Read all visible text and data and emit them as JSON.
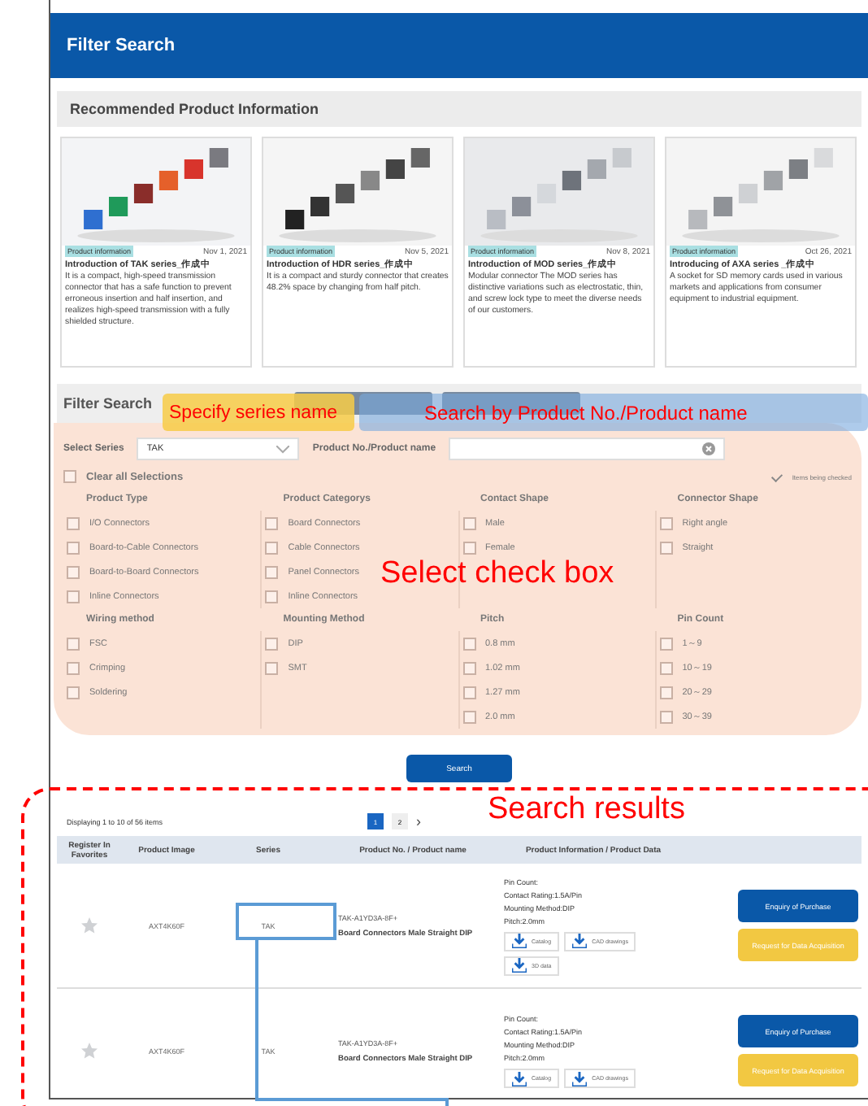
{
  "header": {
    "title": "Filter Search"
  },
  "recommended": {
    "title": "Recommended Product Information",
    "cards": [
      {
        "kind": "picture",
        "tag": "Product information",
        "date": "Nov 1, 2021",
        "title": "Introduction of TAK series_作成中",
        "text": "It is a compact, high-speed transmission connector that has a safe function to prevent erroneous insertion and half insertion, and realizes high-speed transmission with a fully shielded structure."
      },
      {
        "kind": "picture",
        "tag": "Product information",
        "date": "Nov 5, 2021",
        "title": "Introduction of HDR series_作成中",
        "text": "It is a compact and sturdy connector that creates 48.2% space by changing from half pitch."
      },
      {
        "kind": "picture",
        "tag": "Product information",
        "date": "Nov 8, 2021",
        "title": "Introduction of MOD series_作成中",
        "text": "Modular connector The MOD series has distinctive variations such as electrostatic, thin, and screw lock type to meet the diverse needs of our customers."
      },
      {
        "kind": "picture",
        "tag": "Product information",
        "date": "Oct 26, 2021",
        "title": "Introducing of AXA series _作成中",
        "text": "A socket for SD memory cards used in various markets and applications from consumer equipment to industrial equipment."
      }
    ]
  },
  "filter": {
    "title": "Filter Search",
    "buttons": [
      {
        "kind": "blank"
      },
      {
        "kind": "blank"
      }
    ],
    "series_label": "Select Series",
    "series_value": "TAK",
    "product_label": "Product No./Product name",
    "clear_all": {
      "label": "Clear all Selections",
      "checked": false
    },
    "items_only": {
      "label": "Items being checked",
      "checked": true
    },
    "groups": [
      {
        "title": "Product Type",
        "options": [
          {
            "label": "I/O Connectors",
            "checked": false
          },
          {
            "label": "Board-to-Cable Connectors",
            "checked": false
          },
          {
            "label": "Board-to-Board Connectors",
            "checked": false
          },
          {
            "label": "Inline Connectors",
            "checked": false
          }
        ]
      },
      {
        "title": "Product Categorys",
        "options": [
          {
            "label": "Board Connectors",
            "checked": false
          },
          {
            "label": "Cable Connectors",
            "checked": false
          },
          {
            "label": "Panel Connectors",
            "checked": false
          },
          {
            "label": "Inline Connectors",
            "checked": false
          }
        ]
      },
      {
        "title": "Contact Shape",
        "options": [
          {
            "label": "Male",
            "checked": false
          },
          {
            "label": "Female",
            "checked": false
          }
        ]
      },
      {
        "title": "Connector Shape",
        "options": [
          {
            "label": "Right angle",
            "checked": false
          },
          {
            "label": "Straight",
            "checked": false
          }
        ]
      },
      {
        "title": "Wiring method",
        "options": [
          {
            "label": "FSC",
            "checked": false
          },
          {
            "label": "Crimping",
            "checked": false
          },
          {
            "label": "Soldering",
            "checked": false
          }
        ]
      },
      {
        "title": "Mounting Method",
        "options": [
          {
            "label": "DIP",
            "checked": false
          },
          {
            "label": "SMT",
            "checked": false
          }
        ]
      },
      {
        "title": "Pitch",
        "options": [
          {
            "label": "0.8 mm",
            "checked": false
          },
          {
            "label": "1.02 mm",
            "checked": false
          },
          {
            "label": "1.27 mm",
            "checked": false
          },
          {
            "label": "2.0 mm",
            "checked": false
          }
        ]
      },
      {
        "title": "Pin Count",
        "options": [
          {
            "label": "1～9",
            "checked": false
          },
          {
            "label": "10～19",
            "checked": false
          },
          {
            "label": "20～29",
            "checked": false
          },
          {
            "label": "30～39",
            "checked": false
          }
        ]
      }
    ],
    "search_button": "Search"
  },
  "results": {
    "summary": "Displaying 1 to 10 of 56 items",
    "pages": [
      {
        "label": "1",
        "selected": true
      },
      {
        "label": "2",
        "selected": false
      }
    ],
    "next": "›",
    "columns": [
      "Register In Favorites",
      "Product Image",
      "Series",
      "Product No. / Product name",
      "Product Information / Product Data"
    ],
    "rows": [
      {
        "favorite": false,
        "image": "AXT4K60F",
        "series": "TAK",
        "number": "TAK-A1YD3A-8F+",
        "name": "Board Connectors Male Straight DIP",
        "info": [
          "Pin Count:",
          "Contact Rating:1.5A/Pin",
          "Mounting Method:DIP",
          "Pitch:2.0mm"
        ],
        "downloads": [
          "Catalog",
          "CAD drawings",
          "3D data"
        ],
        "actions": [
          "Enquiry of Purchase",
          "Request for Data Acquisition"
        ]
      },
      {
        "favorite": false,
        "image": "AXT4K60F",
        "series": "TAK",
        "number": "TAK-A1YD3A-8F+",
        "name": "Board Connectors Male Straight DIP",
        "info": [
          "Pin Count:",
          "Contact Rating:1.5A/Pin",
          "Mounting Method:DIP",
          "Pitch:2.0mm"
        ],
        "downloads": [
          "Catalog",
          "CAD drawings"
        ],
        "actions": [
          "Enquiry of Purchase",
          "Request for Data Acquisition"
        ]
      }
    ]
  },
  "annotations": {
    "series": "Specify series name",
    "product": "Search by Product No./Product name",
    "checkbox": "Select check box",
    "results": "Search results"
  }
}
